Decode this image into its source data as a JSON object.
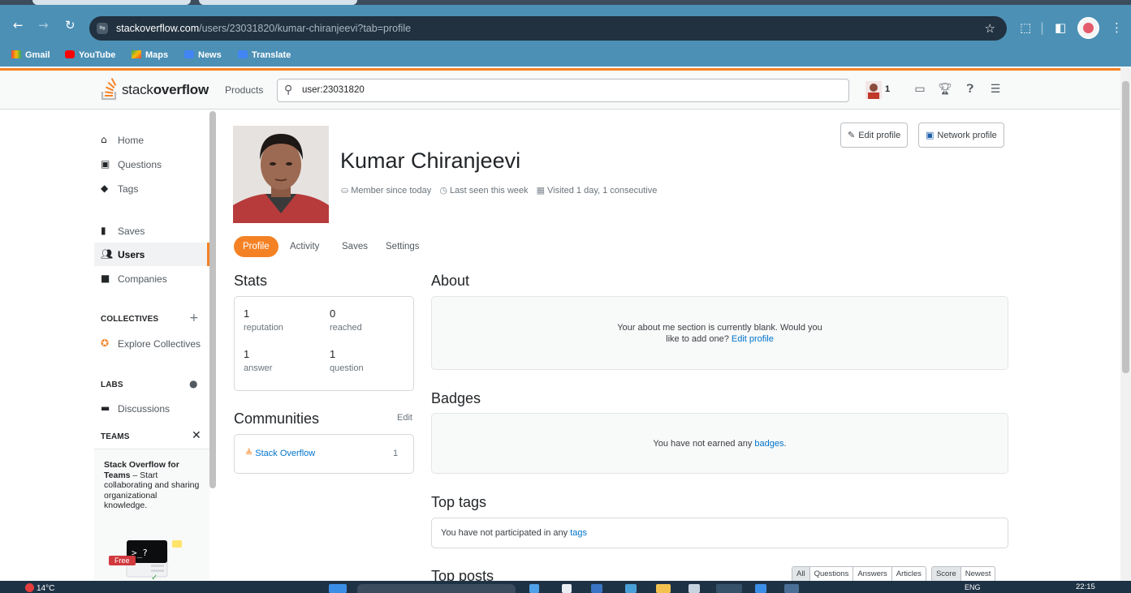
{
  "browser": {
    "url_host": "stackoverflow.com",
    "url_path": "/users/23031820/kumar-chiranjeevi?tab=profile",
    "bookmarks": [
      "Gmail",
      "YouTube",
      "Maps",
      "News",
      "Translate"
    ]
  },
  "topbar": {
    "logo_light": "stack",
    "logo_bold": "overflow",
    "products": "Products",
    "search_value": "user:23031820",
    "reputation": "1"
  },
  "sidebar": {
    "items": [
      {
        "label": "Home",
        "icon": "home-icon"
      },
      {
        "label": "Questions",
        "icon": "questions-icon"
      },
      {
        "label": "Tags",
        "icon": "tag-icon"
      },
      {
        "label": "Saves",
        "icon": "bookmark-icon"
      },
      {
        "label": "Users",
        "icon": "users-icon"
      },
      {
        "label": "Companies",
        "icon": "briefcase-icon"
      }
    ],
    "collectives_header": "COLLECTIVES",
    "explore_collectives": "Explore Collectives",
    "labs_header": "LABS",
    "discussions": "Discussions",
    "teams_header": "TEAMS",
    "teams_title": "Stack Overflow for Teams",
    "teams_text": " – Start collaborating and sharing organizational knowledge.",
    "teams_badge": "Free"
  },
  "profile": {
    "name": "Kumar Chiranjeevi",
    "member_since": "Member since today",
    "last_seen": "Last seen this week",
    "visited": "Visited 1 day, 1 consecutive",
    "edit_profile": "Edit profile",
    "network_profile": "Network profile"
  },
  "tabs": [
    {
      "label": "Profile",
      "active": true
    },
    {
      "label": "Activity",
      "active": false
    },
    {
      "label": "Saves",
      "active": false
    },
    {
      "label": "Settings",
      "active": false
    }
  ],
  "stats": {
    "title": "Stats",
    "items": [
      {
        "value": "1",
        "label": "reputation"
      },
      {
        "value": "0",
        "label": "reached"
      },
      {
        "value": "1",
        "label": "answer"
      },
      {
        "value": "1",
        "label": "question"
      }
    ]
  },
  "communities": {
    "title": "Communities",
    "edit": "Edit",
    "items": [
      {
        "name": "Stack Overflow",
        "count": "1"
      }
    ]
  },
  "about": {
    "title": "About",
    "message_line1": "Your about me section is currently blank. Would you",
    "message_line2": "like to add one?",
    "link": "Edit profile"
  },
  "badges": {
    "title": "Badges",
    "message": "You have not earned any",
    "link": "badges",
    "suffix": "."
  },
  "top_tags": {
    "title": "Top tags",
    "message": "You have not participated in any",
    "link": "tags"
  },
  "top_posts": {
    "title": "Top posts",
    "filter_type": [
      "All",
      "Questions",
      "Answers",
      "Articles"
    ],
    "filter_sort": [
      "Score",
      "Newest"
    ]
  },
  "taskbar": {
    "temperature": "14°C",
    "language": "ENG",
    "time": "22:15"
  },
  "colors": {
    "accent": "#f48225",
    "link": "#0074cc",
    "browser_bar": "#4c90b5"
  }
}
